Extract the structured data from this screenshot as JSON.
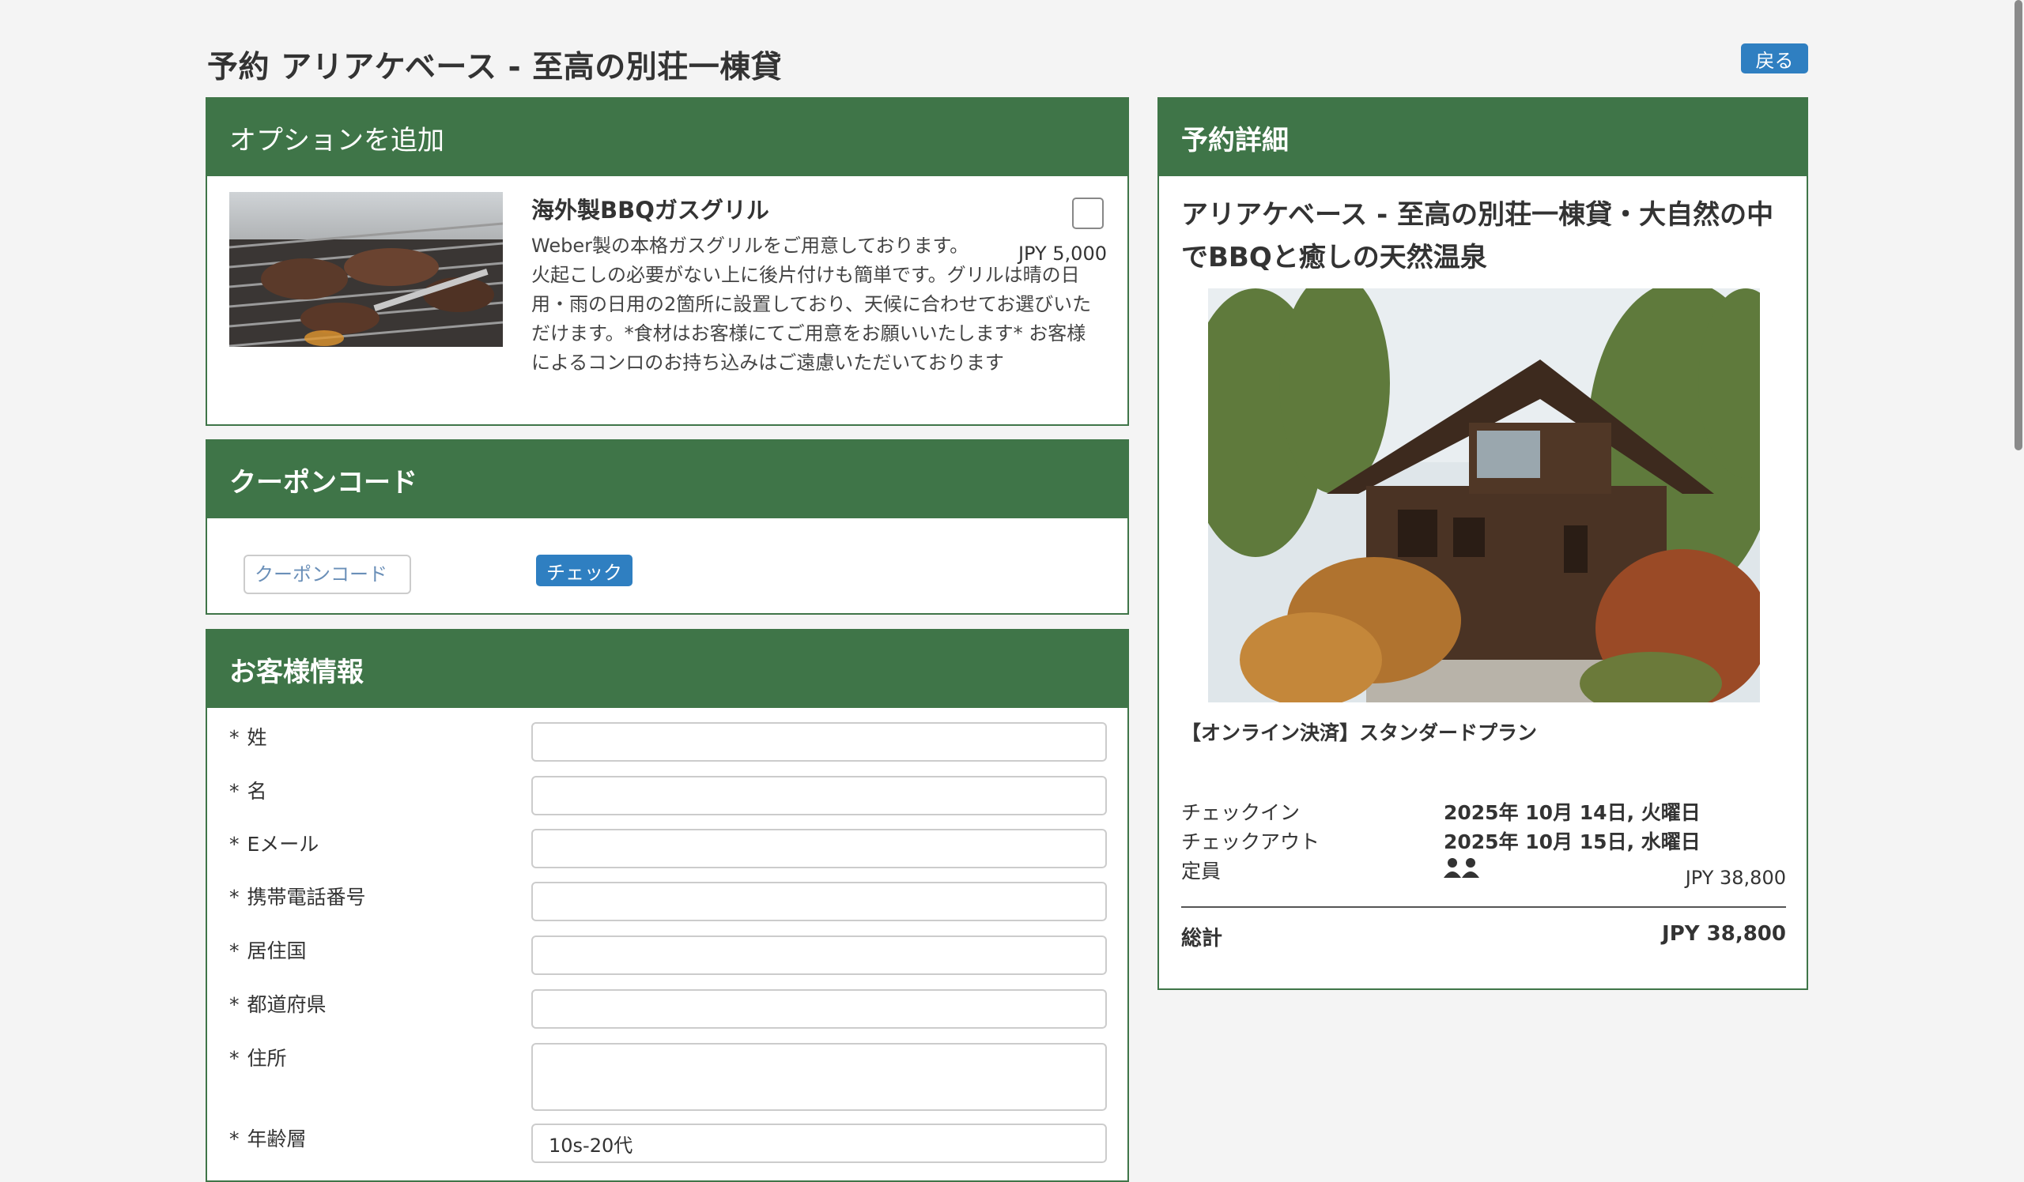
{
  "page": {
    "title": "予約  アリアケベース - 至高の別荘一棟貸",
    "back_label": "戻る"
  },
  "options": {
    "header": "オプションを追加",
    "item": {
      "title": "海外製BBQガスグリル",
      "desc_first": "Weber製の本格ガスグリルをご用意しております。",
      "desc_rest": "火起こしの必要がない上に後片付けも簡単です。グリルは晴の日用・雨の日用の2箇所に設置しており、天候に合わせてお選びいただけます。*食材はお客様にてご用意をお願いいたします* お客様によるコンロのお持ち込みはご遠慮いただいております",
      "price": "JPY 5,000"
    }
  },
  "coupon": {
    "header": "クーポンコード",
    "placeholder": "クーポンコード",
    "check_label": "チェック"
  },
  "customer": {
    "header": "お客様情報",
    "required_mark": "*",
    "fields": [
      {
        "label": "姓"
      },
      {
        "label": "名"
      },
      {
        "label": "Eメール"
      },
      {
        "label": "携帯電話番号"
      },
      {
        "label": "居住国"
      },
      {
        "label": "都道府県"
      },
      {
        "label": "住所"
      },
      {
        "label": "年齢層",
        "value": "10s-20代"
      }
    ]
  },
  "details": {
    "header": "予約詳細",
    "title": "アリアケベース - 至高の別荘一棟貸・大自然の中でBBQと癒しの天然温泉",
    "plan": "【オンライン決済】スタンダードプラン",
    "checkin_label": "チェックイン",
    "checkin_value": "2025年 10月 14日, 火曜日",
    "checkout_label": "チェックアウト",
    "checkout_value": "2025年 10月 15日, 水曜日",
    "capacity_label": "定員",
    "capacity_icon": "two-people-icon",
    "room_price": "JPY 38,800",
    "total_label": "総計",
    "total_value": "JPY 38,800"
  },
  "colors": {
    "header_green": "#3f7548",
    "button_blue": "#2f7fc1"
  }
}
